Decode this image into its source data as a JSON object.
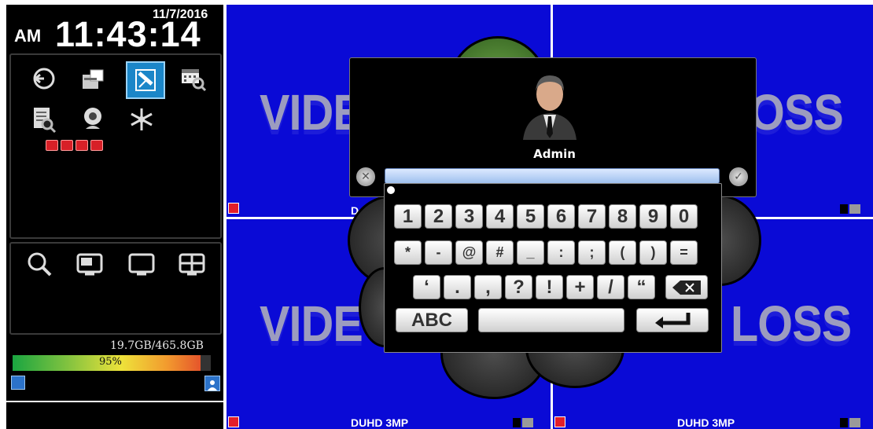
{
  "clock": {
    "date": "11/7/2016",
    "ampm": "AM",
    "time": "11:43:14"
  },
  "toolbar_icons": [
    "playback-icon",
    "backup-icon",
    "record-icon",
    "schedule-search-icon",
    "log-search-icon",
    "camera-icon",
    "freeze-icon"
  ],
  "display_icons": [
    "zoom-icon",
    "pip-icon",
    "single-view-icon",
    "quad-view-icon"
  ],
  "storage": {
    "used": "19.7GB/465.8GB",
    "percent_label": "95%",
    "percent": 0.95
  },
  "cameras": [
    {
      "left_text": "VIDE",
      "right_text": "",
      "label": ""
    },
    {
      "left_text": "",
      "right_text": "OSS",
      "label": ""
    },
    {
      "left_text": "VIDE",
      "right_text": "",
      "label": "DUHD 3MP"
    },
    {
      "left_text": "",
      "right_text": "LOSS",
      "label": "DUHD 3MP"
    }
  ],
  "cam_label_partial": "D",
  "login": {
    "user": "Admin",
    "password": ""
  },
  "keyboard": {
    "row1": [
      "1",
      "2",
      "3",
      "4",
      "5",
      "6",
      "7",
      "8",
      "9",
      "0"
    ],
    "row2": [
      "*",
      "-",
      "@",
      "#",
      "_",
      ":",
      ";",
      "(",
      ")",
      "="
    ],
    "row3": [
      "‘",
      ".",
      ",",
      "?",
      "!",
      "+",
      "/",
      "“"
    ],
    "abc_label": "ABC",
    "space_label": ""
  },
  "colors": {
    "video_bg": "#0a0ad6",
    "panel": "#000000",
    "record": "#d72027"
  }
}
